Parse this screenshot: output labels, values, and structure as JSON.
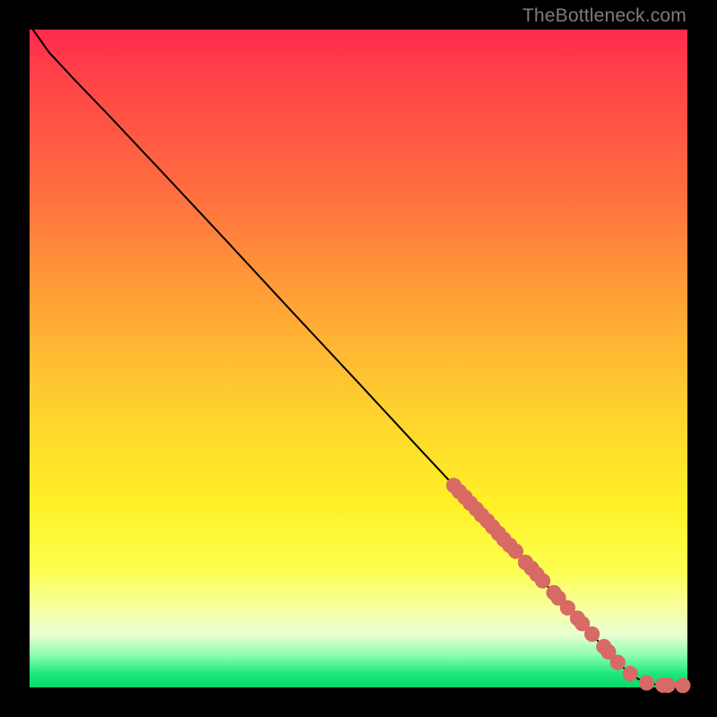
{
  "watermark": "TheBottleneck.com",
  "colors": {
    "marker": "#d86a66",
    "curve": "#000000"
  },
  "chart_data": {
    "type": "line",
    "title": "",
    "xlabel": "",
    "ylabel": "",
    "xlim": [
      0,
      100
    ],
    "ylim": [
      0,
      100
    ],
    "grid": false,
    "curve": [
      {
        "x": 0.5,
        "y": 100
      },
      {
        "x": 3,
        "y": 96.5
      },
      {
        "x": 7,
        "y": 92.2
      },
      {
        "x": 12,
        "y": 87.0
      },
      {
        "x": 20,
        "y": 78.5
      },
      {
        "x": 30,
        "y": 67.8
      },
      {
        "x": 40,
        "y": 57.0
      },
      {
        "x": 50,
        "y": 46.3
      },
      {
        "x": 60,
        "y": 35.5
      },
      {
        "x": 70,
        "y": 24.8
      },
      {
        "x": 80,
        "y": 14.0
      },
      {
        "x": 86,
        "y": 7.5
      },
      {
        "x": 90,
        "y": 3.2
      },
      {
        "x": 92.5,
        "y": 1.3
      },
      {
        "x": 94,
        "y": 0.6
      },
      {
        "x": 96,
        "y": 0.35
      },
      {
        "x": 100,
        "y": 0.3
      }
    ],
    "markers": [
      {
        "x": 64.5,
        "y": 30.7
      },
      {
        "x": 65.3,
        "y": 29.8
      },
      {
        "x": 66.2,
        "y": 28.9
      },
      {
        "x": 67.0,
        "y": 28.0
      },
      {
        "x": 67.9,
        "y": 27.1
      },
      {
        "x": 68.7,
        "y": 26.2
      },
      {
        "x": 69.6,
        "y": 25.3
      },
      {
        "x": 70.4,
        "y": 24.4
      },
      {
        "x": 71.3,
        "y": 23.4
      },
      {
        "x": 72.1,
        "y": 22.5
      },
      {
        "x": 73.0,
        "y": 21.6
      },
      {
        "x": 73.9,
        "y": 20.7
      },
      {
        "x": 75.4,
        "y": 19.0
      },
      {
        "x": 76.3,
        "y": 18.1
      },
      {
        "x": 77.1,
        "y": 17.2
      },
      {
        "x": 78.0,
        "y": 16.2
      },
      {
        "x": 79.7,
        "y": 14.4
      },
      {
        "x": 80.4,
        "y": 13.6
      },
      {
        "x": 81.8,
        "y": 12.1
      },
      {
        "x": 83.3,
        "y": 10.5
      },
      {
        "x": 84.0,
        "y": 9.7
      },
      {
        "x": 85.5,
        "y": 8.1
      },
      {
        "x": 87.3,
        "y": 6.2
      },
      {
        "x": 88.0,
        "y": 5.4
      },
      {
        "x": 89.4,
        "y": 3.8
      },
      {
        "x": 91.3,
        "y": 2.1
      },
      {
        "x": 93.8,
        "y": 0.7
      },
      {
        "x": 96.3,
        "y": 0.35
      },
      {
        "x": 97.0,
        "y": 0.33
      },
      {
        "x": 99.3,
        "y": 0.3
      }
    ],
    "marker_radius": 1.1
  }
}
